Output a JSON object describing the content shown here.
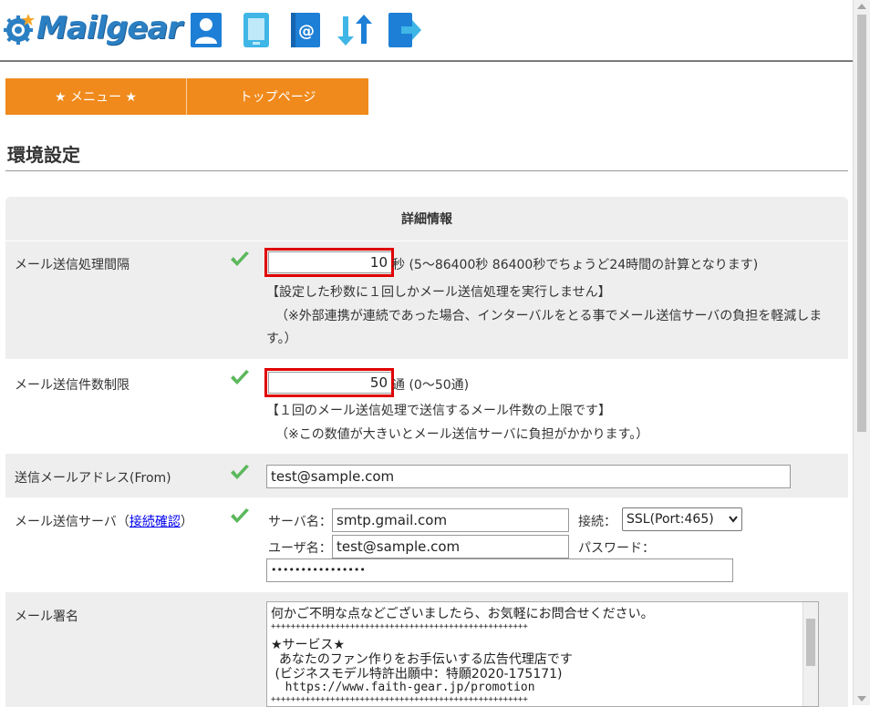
{
  "header": {
    "logo_text": "Mailgear",
    "icons": [
      "user-icon",
      "document-icon",
      "address-book-icon",
      "sync-icon",
      "logout-icon"
    ]
  },
  "menu": {
    "items": [
      {
        "label": "★ メニュー ★"
      },
      {
        "label": "トップページ"
      }
    ]
  },
  "page": {
    "title": "環境設定"
  },
  "panel": {
    "heading": "詳細情報",
    "interval": {
      "label": "メール送信処理間隔",
      "value": "10",
      "suffix": "秒 (5〜86400秒 86400秒でちょうど24時間の計算となります)",
      "note1": "【設定した秒数に１回しかメール送信処理を実行しません】",
      "note2": "（※外部連携が連続であった場合、インターバルをとる事でメール送信サーバの負担を軽減しま",
      "note3": "す。）"
    },
    "limit": {
      "label": "メール送信件数制限",
      "value": "50",
      "suffix": "通 (0〜50通)",
      "note1": "【１回のメール送信処理で送信するメール件数の上限です】",
      "note2": "（※この数値が大きいとメール送信サーバに負担がかかります。）"
    },
    "from": {
      "label": "送信メールアドレス(From)",
      "value": "test@sample.com"
    },
    "server": {
      "label_prefix": "メール送信サーバ（",
      "label_link": "接続確認",
      "label_suffix": "）",
      "server_name_label": "サーバ名：",
      "server_name_value": "smtp.gmail.com",
      "connection_label": "接続：",
      "connection_value": "SSL(Port:465)",
      "user_label": "ユーザ名：",
      "user_value": "test@sample.com",
      "password_label": "パスワード：",
      "password_value": "••••••••••••••••"
    },
    "signature": {
      "label": "メール署名",
      "lines": [
        "何かご不明な点などございましたら、お気軽にお問合せください。",
        "++++++++++++++++++++++++++++++++++++++++++++++++++++",
        "★サービス★",
        "  あなたのファン作りをお手伝いする広告代理店です",
        " (ビジネスモデル特許出願中：特願2020-175171)",
        "  https://www.faith-gear.jp/promotion",
        "++++++++++++++++++++++++++++++++++++++++++++++++++++"
      ]
    }
  },
  "colors": {
    "accent_orange": "#f08a1c",
    "highlight_red": "#e00000",
    "check_green": "#4caf50"
  }
}
